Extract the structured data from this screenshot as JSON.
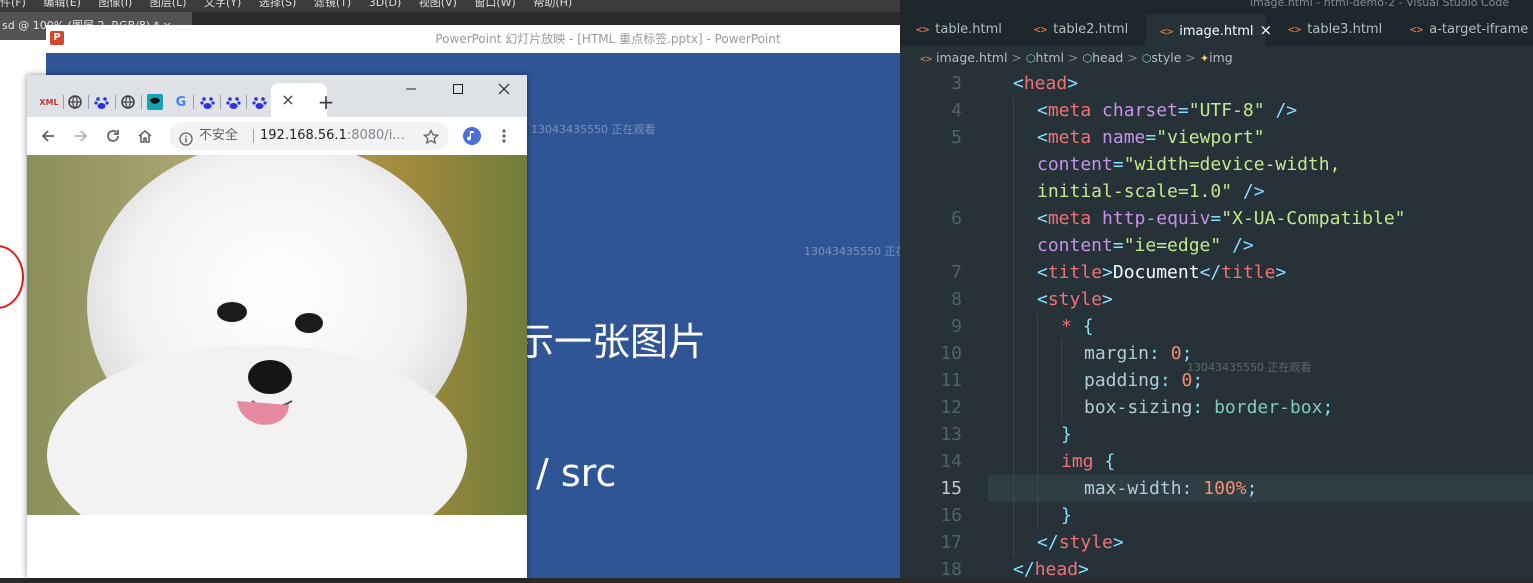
{
  "photoshop": {
    "menu_items": [
      "件(F)",
      "编辑(E)",
      "图像(I)",
      "图层(L)",
      "文字(Y)",
      "选择(S)",
      "滤镜(T)",
      "3D(D)",
      "视图(V)",
      "窗口(W)",
      "帮助(H)"
    ],
    "doc_tab": "sd @ 100% (图层 2, RGB/8) * ×"
  },
  "powerpoint": {
    "icon_letter": "P",
    "title": "PowerPoint 幻灯片放映 - [HTML 重点标签.pptx] - PowerPoint",
    "slide_line1": "示一张图片",
    "slide_line2": "/ src",
    "watermark": "13043435550 正在观看"
  },
  "chrome": {
    "tabs": [
      "XML",
      "globe",
      "baidu",
      "globe",
      "mask",
      "G",
      "baidu",
      "baidu",
      "baidu"
    ],
    "close_glyph": "×",
    "new_tab_glyph": "+",
    "security_label": "不安全",
    "url_host": "192.168.56.1",
    "url_rest": ":8080/i...",
    "image_alt": "white bichon dog"
  },
  "vscode": {
    "window_title": "image.html - html-demo-2 - Visual Studio Code",
    "tabs": [
      {
        "label": "table.html",
        "active": false
      },
      {
        "label": "table2.html",
        "active": false
      },
      {
        "label": "image.html",
        "active": true
      },
      {
        "label": "table3.html",
        "active": false
      },
      {
        "label": "a-target-iframe",
        "active": false
      }
    ],
    "tab_close": "×",
    "breadcrumb": [
      "image.html",
      "html",
      "head",
      "style",
      "img"
    ],
    "watermark": "13043435550 正在观看",
    "current_line": 15,
    "line_numbers": [
      "3",
      "4",
      "5",
      "",
      "",
      "6",
      "",
      "7",
      "8",
      "9",
      "10",
      "11",
      "12",
      "13",
      "14",
      "15",
      "16",
      "17",
      "18"
    ],
    "code": {
      "l3_tag": "head",
      "l4_tag": "meta",
      "l4_attr": "charset",
      "l4_val": "\"UTF-8\"",
      "l5_tag": "meta",
      "l5_attr": "name",
      "l5_val": "\"viewport\"",
      "l5b_attr": "content",
      "l5b_val": "\"width=device-width,",
      "l5c_val": "initial-scale=1.0\"",
      "l6_tag": "meta",
      "l6_attr": "http-equiv",
      "l6_val": "\"X-UA-Compatible\"",
      "l6b_attr": "content",
      "l6b_val": "\"ie=edge\"",
      "l7_tag": "title",
      "l7_text": "Document",
      "l8_tag": "style",
      "l9_sel": "*",
      "l10_prop": "margin",
      "l10_val": "0",
      "l11_prop": "padding",
      "l11_val": "0",
      "l12_prop": "box-sizing",
      "l12_val": "border-box",
      "l14_sel": "img",
      "l15_prop": "max-width",
      "l15_val": "100%",
      "l17_tag": "style",
      "l18_tag": "head"
    }
  }
}
